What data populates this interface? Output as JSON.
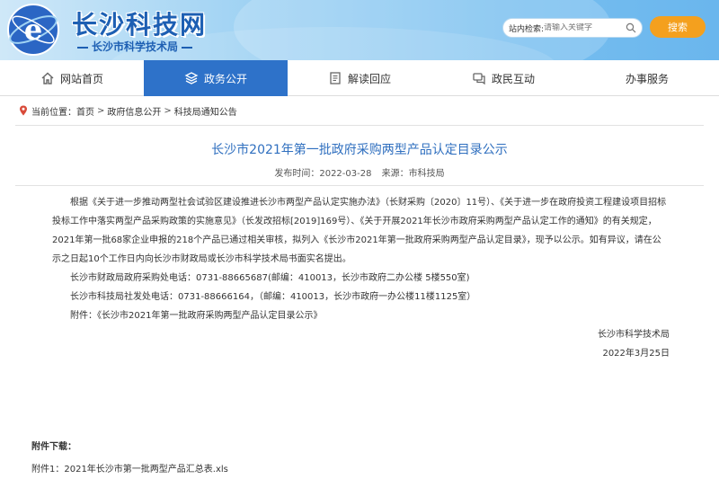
{
  "header": {
    "site_title": "长沙科技网",
    "site_subtitle": "长沙市科学技术局",
    "search": {
      "label": "站内检索:",
      "placeholder": "请输入关键字",
      "button_label": "搜索"
    },
    "colors": {
      "brand_blue": "#1d5fb3",
      "search_button": "#f4a01e",
      "nav_active": "#2e72c9"
    }
  },
  "nav": {
    "items": [
      {
        "label": "网站首页",
        "icon": "home-icon",
        "active": false
      },
      {
        "label": "政务公开",
        "icon": "layers-icon",
        "active": true
      },
      {
        "label": "解读回应",
        "icon": "document-icon",
        "active": false
      },
      {
        "label": "政民互动",
        "icon": "chat-icon",
        "active": false
      },
      {
        "label": "办事服务",
        "icon": "",
        "active": false
      }
    ]
  },
  "breadcrumb": {
    "prefix": "当前位置：",
    "items": [
      "首页",
      "政府信息公开",
      "科技局通知公告"
    ],
    "separator": ">"
  },
  "article": {
    "title": "长沙市2021年第一批政府采购两型产品认定目录公示",
    "publish_time": "发布时间：2022-03-28",
    "source": "来源：市科技局",
    "paragraph_1": "根据《关于进一步推动两型社会试验区建设推进长沙市两型产品认定实施办法》（长财采购〔2020〕11号）、《关于进一步在政府投资工程建设项目招标投标工作中落实两型产品采购政策的实施意见》（长发改招标[2019]169号）、《关于开展2021年长沙市政府采购两型产品认定工作的通知》的有关规定，2021年第一批68家企业申报的218个产品已通过相关审核，拟列入《长沙市2021年第一批政府采购两型产品认定目录》，现予以公示。如有异议，请在公示之日起10个工作日内向长沙市财政局或长沙市科学技术局书面实名提出。",
    "contact_1": "长沙市财政局政府采购处电话：0731-88665687(邮编：410013，长沙市政府二办公楼 5楼550室)",
    "contact_2": "长沙市科技局社发处电话：0731-88666164，（邮编：410013，长沙市政府一办公楼11楼1125室）",
    "attachment_line": "附件：《长沙市2021年第一批政府采购两型产品认定目录公示》",
    "signature": "长沙市科学技术局",
    "date": "2022年3月25日"
  },
  "attachments": {
    "title": "附件下载：",
    "items": [
      "附件1：2021年长沙市第一批两型产品汇总表.xls"
    ]
  }
}
